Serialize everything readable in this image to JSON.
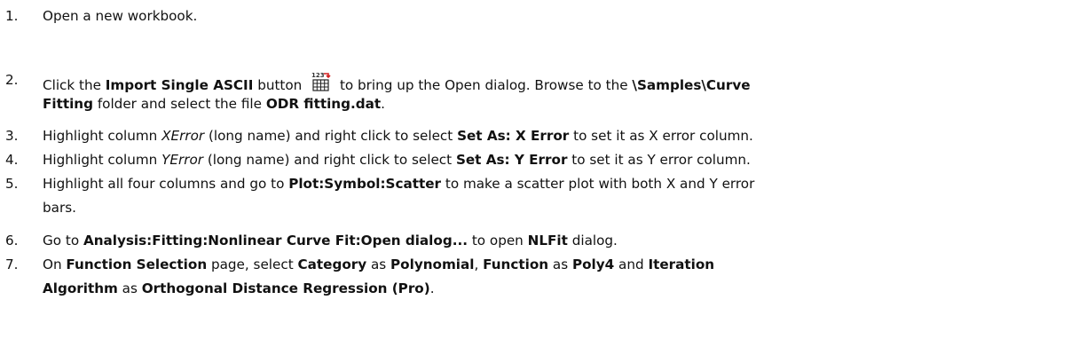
{
  "steps": [
    {
      "number": "1.",
      "lines": [
        [
          {
            "t": "Open a new workbook."
          }
        ]
      ]
    },
    {
      "number": "2.",
      "lines": [
        [
          {
            "t": "Click the "
          },
          {
            "t": "Import Single ASCII",
            "b": true
          },
          {
            "t": " button "
          },
          {
            "icon": "import-single-ascii-icon",
            "icon_text": "123"
          },
          {
            "t": " to bring up the Open dialog. Browse to the "
          },
          {
            "t": "\\Samples\\Curve",
            "b": true
          }
        ],
        [
          {
            "t": "Fitting",
            "b": true
          },
          {
            "t": " folder and select the file "
          },
          {
            "t": "ODR fitting.dat",
            "b": true
          },
          {
            "t": "."
          }
        ]
      ]
    },
    {
      "number": "3.",
      "lines": [
        [
          {
            "t": "Highlight column "
          },
          {
            "t": "XError",
            "i": true
          },
          {
            "t": " (long name) and right click to select "
          },
          {
            "t": "Set As: X Error",
            "b": true
          },
          {
            "t": " to set it as X error column."
          }
        ]
      ]
    },
    {
      "number": "4.",
      "lines": [
        [
          {
            "t": "Highlight column "
          },
          {
            "t": "YError",
            "i": true
          },
          {
            "t": " (long name) and right click to select "
          },
          {
            "t": "Set As: Y Error",
            "b": true
          },
          {
            "t": " to set it as Y error column."
          }
        ]
      ]
    },
    {
      "number": "5.",
      "lines": [
        [
          {
            "t": "Highlight all four columns and go to "
          },
          {
            "t": "Plot:Symbol:Scatter",
            "b": true
          },
          {
            "t": " to make a scatter plot with both X and Y error"
          }
        ],
        [
          {
            "t": "bars."
          }
        ]
      ]
    },
    {
      "number": "6.",
      "lines": [
        [
          {
            "t": "Go to "
          },
          {
            "t": "Analysis:Fitting:Nonlinear Curve Fit:Open dialog...",
            "b": true
          },
          {
            "t": " to open "
          },
          {
            "t": "NLFit",
            "b": true
          },
          {
            "t": " dialog."
          }
        ]
      ]
    },
    {
      "number": "7.",
      "lines": [
        [
          {
            "t": "On "
          },
          {
            "t": "Function Selection",
            "b": true
          },
          {
            "t": " page, select "
          },
          {
            "t": "Category",
            "b": true
          },
          {
            "t": " as "
          },
          {
            "t": "Polynomial",
            "b": true
          },
          {
            "t": ", "
          },
          {
            "t": "Function",
            "b": true
          },
          {
            "t": " as "
          },
          {
            "t": "Poly4",
            "b": true
          },
          {
            "t": " and "
          },
          {
            "t": "Iteration",
            "b": true
          }
        ],
        [
          {
            "t": "Algorithm",
            "b": true
          },
          {
            "t": " as "
          },
          {
            "t": "Orthogonal Distance Regression (Pro)",
            "b": true
          },
          {
            "t": "."
          }
        ]
      ]
    }
  ]
}
